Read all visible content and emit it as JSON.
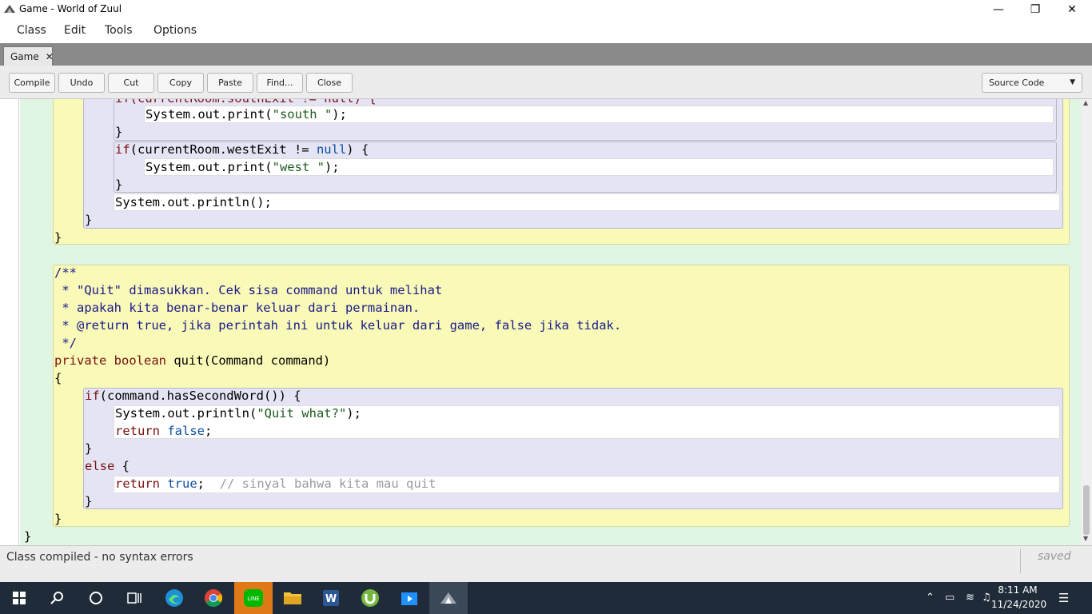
{
  "window": {
    "title": "Game - World of Zuul"
  },
  "menu": [
    "Class",
    "Edit",
    "Tools",
    "Options"
  ],
  "tab": {
    "label": "Game"
  },
  "toolbar": {
    "buttons": [
      "Compile",
      "Undo",
      "Cut",
      "Copy",
      "Paste",
      "Find...",
      "Close"
    ],
    "view_selected": "Source Code"
  },
  "code": {
    "l0": "if(currentRoom.southExit != null) {",
    "l1_pre": "System.out.print(",
    "l1_str": "\"south \"",
    "l1_post": ");",
    "l2": "}",
    "l3_kw": "if",
    "l3_mid": "(currentRoom.westExit != ",
    "l3_lit": "null",
    "l3_post": ") {",
    "l4_pre": "System.out.print(",
    "l4_str": "\"west \"",
    "l4_post": ");",
    "l5": "}",
    "l6": "System.out.println();",
    "l7": "}",
    "l8": "}",
    "c1": "/**",
    "c2": " * \"Quit\" dimasukkan. Cek sisa command untuk melihat",
    "c3": " * apakah kita benar-benar keluar dari permainan.",
    "c4": " * @return true, jika perintah ini untuk keluar dari game, false jika tidak.",
    "c5": " */",
    "m1_kw1": "private",
    "m1_kw2": "boolean",
    "m1_rest": "quit(Command command)",
    "m2": "{",
    "m3_kw": "if",
    "m3_rest": "(command.hasSecondWord()) {",
    "m4_pre": "System.out.println(",
    "m4_str": "\"Quit what?\"",
    "m4_post": ");",
    "m5_kw": "return",
    "m5_lit": "false",
    "m5_post": ";",
    "m6": "}",
    "m7_kw": "else",
    "m7_post": " {",
    "m8_kw": "return",
    "m8_lit": "true",
    "m8_post": ";",
    "m8_cm": "// sinyal bahwa kita mau quit",
    "m9": "}",
    "m10": "}",
    "m11": "}"
  },
  "status": {
    "message": "Class compiled - no syntax errors",
    "saved": "saved"
  },
  "clock": {
    "time": "8:11 AM",
    "date": "11/24/2020"
  }
}
